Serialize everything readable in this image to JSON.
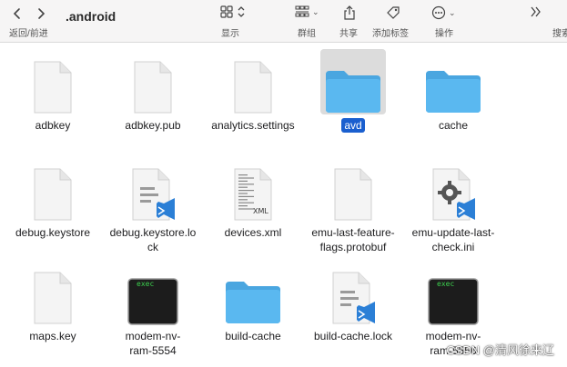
{
  "toolbar": {
    "back_forward_label": "返回/前进",
    "folder_title": ".android",
    "display_label": "显示",
    "group_label": "群组",
    "share_label": "共享",
    "tags_label": "添加标签",
    "actions_label": "操作",
    "search_label": "搜索"
  },
  "files": [
    {
      "name": "adbkey",
      "lines": [
        "adbkey"
      ],
      "icon": "document-icon"
    },
    {
      "name": "adbkey.pub",
      "lines": [
        "adbkey.pub"
      ],
      "icon": "document-icon"
    },
    {
      "name": "analytics.settings",
      "lines": [
        "analytics.settings"
      ],
      "icon": "document-icon"
    },
    {
      "name": "avd",
      "lines": [
        "avd"
      ],
      "icon": "folder-icon",
      "selected": true
    },
    {
      "name": "cache",
      "lines": [
        "cache"
      ],
      "icon": "folder-icon"
    },
    {
      "name": "debug.keystore",
      "lines": [
        "debug.keystore"
      ],
      "icon": "document-icon"
    },
    {
      "name": "debug.keystore.lock",
      "lines": [
        "debug.keystore.lo",
        "ck"
      ],
      "icon": "vscode-document-icon"
    },
    {
      "name": "devices.xml",
      "lines": [
        "devices.xml"
      ],
      "icon": "xml-document-icon",
      "badge": "XML"
    },
    {
      "name": "emu-last-feature-flags.protobuf",
      "lines": [
        "emu-last-feature-",
        "flags.protobuf"
      ],
      "icon": "document-icon"
    },
    {
      "name": "emu-update-last-check.ini",
      "lines": [
        "emu-update-last-",
        "check.ini"
      ],
      "icon": "vscode-settings-icon"
    },
    {
      "name": "maps.key",
      "lines": [
        "maps.key"
      ],
      "icon": "document-icon"
    },
    {
      "name": "modem-nv-ram-5554",
      "lines": [
        "modem-nv-",
        "ram-5554"
      ],
      "icon": "terminal-exec-icon",
      "badge": "exec"
    },
    {
      "name": "build-cache",
      "lines": [
        "build-cache"
      ],
      "icon": "folder-icon"
    },
    {
      "name": "build-cache.lock",
      "lines": [
        "build-cache.lock"
      ],
      "icon": "vscode-document-icon"
    },
    {
      "name": "modem-nv-ram-5556",
      "lines": [
        "modem-nv-",
        "ram-5556"
      ],
      "icon": "terminal-exec-icon",
      "badge": "exec"
    }
  ],
  "watermark": "CSDN @清风徐来辽",
  "colors": {
    "folder": "#5ab8f0",
    "selection": "#1a5fcf",
    "vscode": "#2b7fd6"
  }
}
